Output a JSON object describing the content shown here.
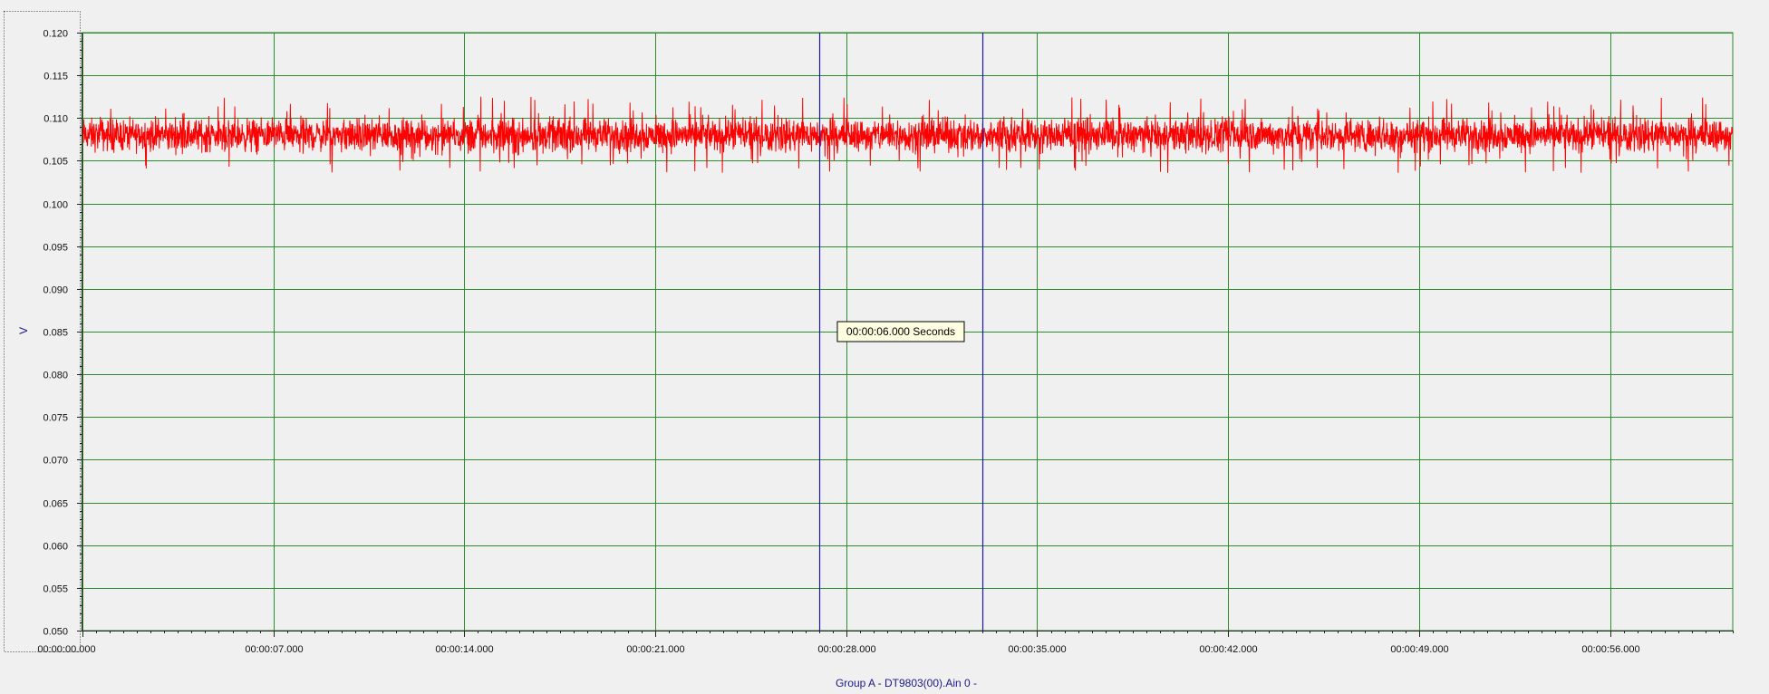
{
  "chart_data": {
    "type": "line",
    "title": "",
    "xlabel": "Group A - DT9803(00).Ain 0 -",
    "ylabel": "V",
    "xlim": [
      0,
      60.5
    ],
    "ylim": [
      0.05,
      0.12
    ],
    "x_ticks": [
      0,
      7,
      14,
      21,
      28,
      35,
      42,
      49,
      56
    ],
    "x_tick_labels": [
      "00:00:00.000",
      "00:00:07.000",
      "00:00:14.000",
      "00:00:21.000",
      "00:00:28.000",
      "00:00:35.000",
      "00:00:42.000",
      "00:00:49.000",
      "00:00:56.000"
    ],
    "y_ticks": [
      0.05,
      0.055,
      0.06,
      0.065,
      0.07,
      0.075,
      0.08,
      0.085,
      0.09,
      0.095,
      0.1,
      0.105,
      0.11,
      0.115,
      0.12
    ],
    "y_tick_labels": [
      "0.050",
      "0.055",
      "0.060",
      "0.065",
      "0.070",
      "0.075",
      "0.080",
      "0.085",
      "0.090",
      "0.095",
      "0.100",
      "0.105",
      "0.110",
      "0.115",
      "0.120"
    ],
    "grid": true,
    "legend": "none",
    "series": [
      {
        "signal": {
          "x_start": 0,
          "x_end": 60.5,
          "mean": 0.108,
          "typical_range": [
            0.105,
            0.1105
          ],
          "peak_range": [
            0.1035,
            0.1125
          ]
        },
        "color": "#ff0000"
      }
    ],
    "cursors": [
      {
        "x": 27,
        "color": "#1a1aa6"
      },
      {
        "x": 33,
        "color": "#1a1aa6"
      }
    ],
    "cursor_readout": {
      "text": "00:00:06.000 Seconds",
      "y": 0.085
    },
    "colors": {
      "background": "#f0f0f0",
      "grid": "#2e8b2e",
      "signal": "#ff0000",
      "cursor": "#1a1aa6",
      "axis_title": "#1a1a8c",
      "readout_bg": "#ffffe1"
    }
  }
}
